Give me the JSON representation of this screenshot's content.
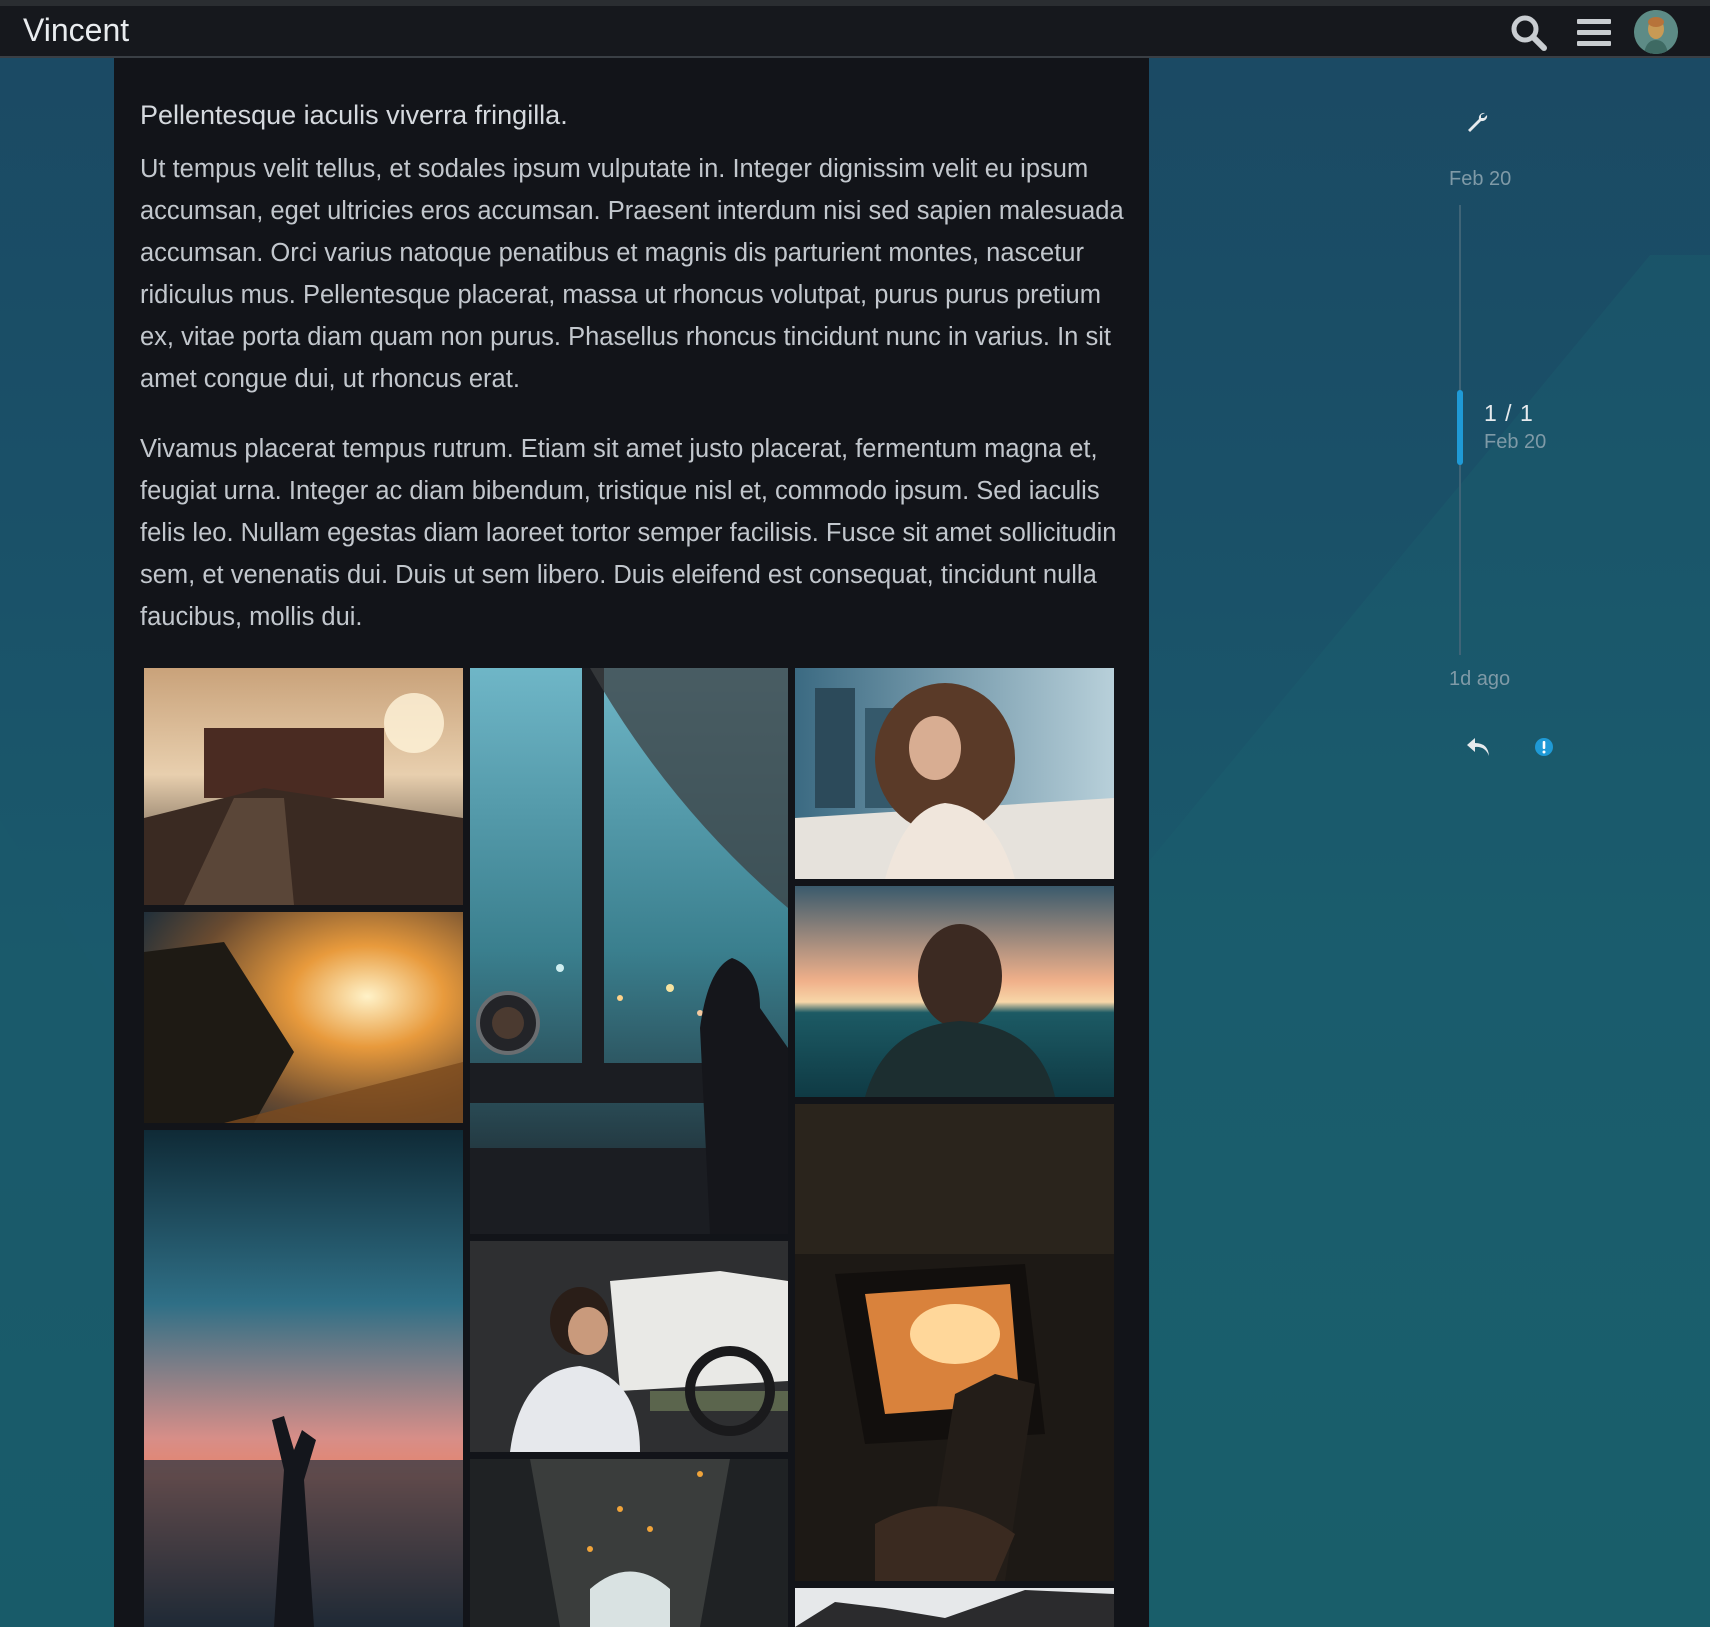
{
  "header": {
    "site_title": "Vincent"
  },
  "post": {
    "title": "Pellentesque iaculis viverra fringilla.",
    "paragraphs": [
      "Ut tempus velit tellus, et sodales ipsum vulputate in. Integer dignissim velit eu ipsum accumsan, eget ultricies eros accumsan. Praesent interdum nisi sed sapien malesuada accumsan. Orci varius natoque penatibus et magnis dis parturient montes, nascetur ridiculus mus. Pellentesque placerat, massa ut rhoncus volutpat, purus purus pretium ex, vitae porta diam quam non purus. Phasellus rhoncus tincidunt nunc in varius. In sit amet congue dui, ut rhoncus erat.",
      "Vivamus placerat tempus rutrum. Etiam sit amet justo placerat, fermentum magna et, feugiat urna. Integer ac diam bibendum, tristique nisl et, commodo ipsum. Sed iaculis felis leo. Nullam egestas diam laoreet tortor semper facilisis. Fusce sit amet sollicitudin sem, et venenatis dui. Duis ut sem libero. Duis eleifend est consequat, tincidunt nulla faucibus, mollis dui."
    ]
  },
  "timeline": {
    "start_date": "Feb 20",
    "position": "1 / 1",
    "position_date": "Feb 20",
    "end_label": "1d ago"
  },
  "icons": {
    "search": "search-icon",
    "menu": "hamburger-menu-icon",
    "admin": "wrench-icon",
    "reply": "reply-icon",
    "flag": "flag-info-icon"
  },
  "colors": {
    "accent": "#1f9ad6",
    "header_bg": "#16181d",
    "post_bg": "#121419"
  }
}
